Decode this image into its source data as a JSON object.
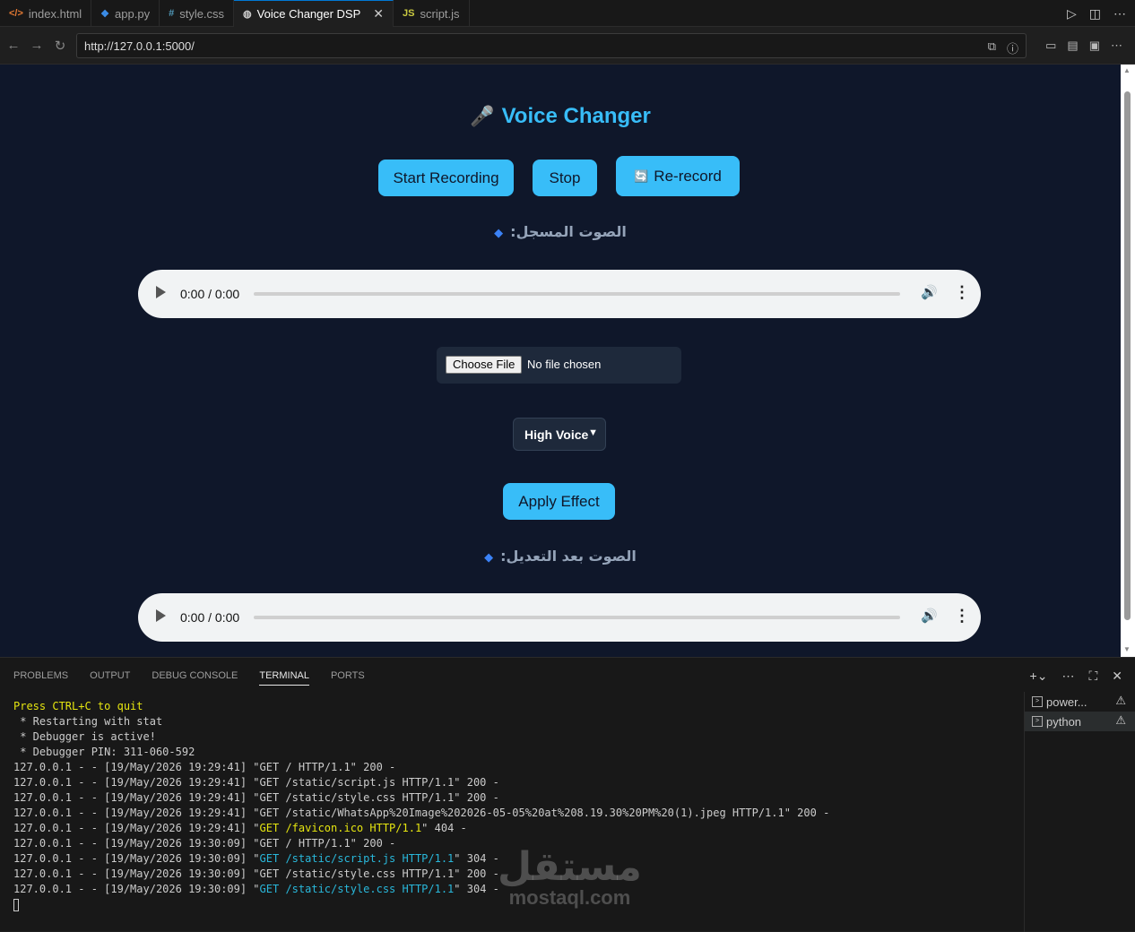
{
  "editor_tabs": [
    {
      "icon": "</>",
      "label": "index.html",
      "icon_color": "#e37933"
    },
    {
      "icon": "❖",
      "label": "app.py",
      "icon_color": "#3b8eea"
    },
    {
      "icon": "#",
      "label": "style.css",
      "icon_color": "#519aba"
    },
    {
      "icon": "◍",
      "label": "Voice Changer DSP",
      "icon_color": "#cccccc",
      "active": true,
      "close": "✕"
    },
    {
      "icon": "JS",
      "label": "script.js",
      "icon_color": "#cbcb41"
    }
  ],
  "browser": {
    "url": "http://127.0.0.1:5000/"
  },
  "page": {
    "title": "Voice Changer",
    "mic_icon": "🎤",
    "start_label": "Start Recording",
    "stop_label": "Stop",
    "rerecord_icon": "🔄",
    "rerecord_label": "Re-record",
    "recorded_label": "الصوت المسجل:",
    "diamond": "◆",
    "recorded_time": "0:00 / 0:00",
    "choose_file": "Choose File",
    "no_file": "No file chosen",
    "effect_selected": "High Voice",
    "apply_label": "Apply Effect",
    "modified_label": "الصوت بعد التعديل:",
    "modified_time": "0:00 / 0:00"
  },
  "panel": {
    "tabs": [
      "PROBLEMS",
      "OUTPUT",
      "DEBUG CONSOLE",
      "TERMINAL",
      "PORTS"
    ],
    "active_tab": "TERMINAL",
    "terminals": [
      {
        "label": "power...",
        "active": false
      },
      {
        "label": "python",
        "active": true
      }
    ]
  },
  "terminal_lines": [
    {
      "parts": [
        {
          "t": "Press CTRL+C to quit",
          "c": "yellow"
        }
      ]
    },
    {
      "parts": [
        {
          "t": " * Restarting with stat"
        }
      ]
    },
    {
      "parts": [
        {
          "t": " * Debugger is active!"
        }
      ]
    },
    {
      "parts": [
        {
          "t": " * Debugger PIN: 311-060-592"
        }
      ]
    },
    {
      "parts": [
        {
          "t": "127.0.0.1 - - [19/May/2026 19:29:41] \"GET / HTTP/1.1\" 200 -"
        }
      ]
    },
    {
      "parts": [
        {
          "t": "127.0.0.1 - - [19/May/2026 19:29:41] \"GET /static/script.js HTTP/1.1\" 200 -"
        }
      ]
    },
    {
      "parts": [
        {
          "t": "127.0.0.1 - - [19/May/2026 19:29:41] \"GET /static/style.css HTTP/1.1\" 200 -"
        }
      ]
    },
    {
      "parts": [
        {
          "t": "127.0.0.1 - - [19/May/2026 19:29:41] \"GET /static/WhatsApp%20Image%202026-05-05%20at%208.19.30%20PM%20(1).jpeg HTTP/1.1\" 200 -"
        }
      ]
    },
    {
      "parts": [
        {
          "t": "127.0.0.1 - - [19/May/2026 19:29:41] \""
        },
        {
          "t": "GET /favicon.ico HTTP/1.1",
          "c": "yellow"
        },
        {
          "t": "\" 404 -"
        }
      ]
    },
    {
      "parts": [
        {
          "t": "127.0.0.1 - - [19/May/2026 19:30:09] \"GET / HTTP/1.1\" 200 -"
        }
      ]
    },
    {
      "parts": [
        {
          "t": "127.0.0.1 - - [19/May/2026 19:30:09] \""
        },
        {
          "t": "GET /static/script.js HTTP/1.1",
          "c": "cyan"
        },
        {
          "t": "\" 304 -"
        }
      ]
    },
    {
      "parts": [
        {
          "t": "127.0.0.1 - - [19/May/2026 19:30:09] \"GET /static/style.css HTTP/1.1\" 200 -"
        }
      ]
    },
    {
      "parts": [
        {
          "t": "127.0.0.1 - - [19/May/2026 19:30:09] \""
        },
        {
          "t": "GET /static/style.css HTTP/1.1",
          "c": "cyan"
        },
        {
          "t": "\" 304 -"
        }
      ]
    }
  ],
  "watermark": {
    "arabic": "مستقل",
    "latin": "mostaql.com"
  },
  "colors": {
    "accent": "#38bdf8",
    "page_bg": "#0f172a"
  }
}
